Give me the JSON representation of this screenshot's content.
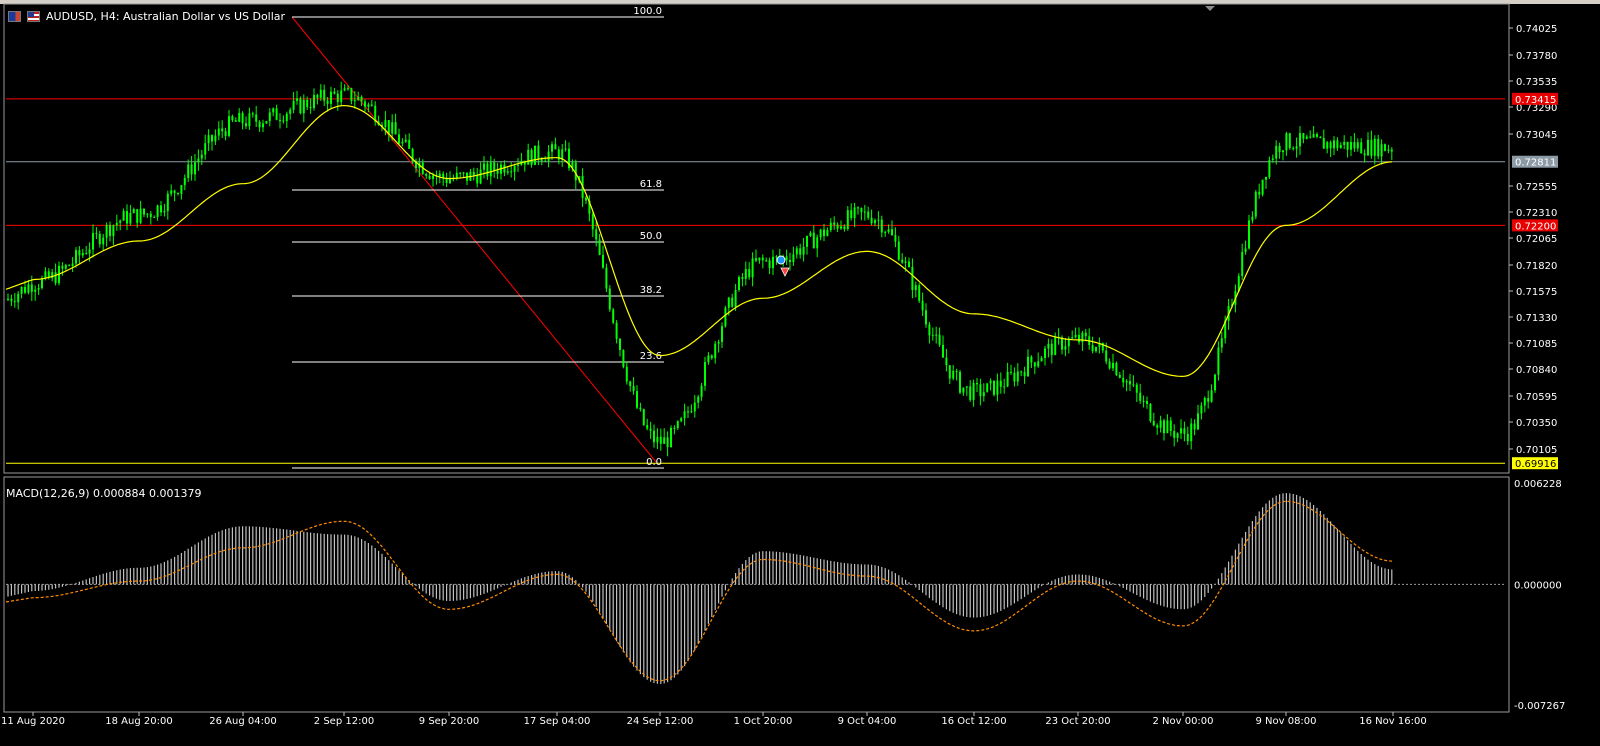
{
  "symbol_header": {
    "text": "AUDUSD, H4:  Australian Dollar vs US Dollar"
  },
  "macd": {
    "label": "MACD(12,26,9) 0.000884 0.001379",
    "axis_labels": [
      "0.006228",
      "0.000000",
      "-0.007267"
    ]
  },
  "price_axis": {
    "labels": [
      "0.74025",
      "0.73780",
      "0.73535",
      "0.73290",
      "0.73045",
      "0.72555",
      "0.72310",
      "0.72065",
      "0.71820",
      "0.71575",
      "0.71330",
      "0.71085",
      "0.70840",
      "0.70595",
      "0.70350",
      "0.70105"
    ],
    "tags": [
      {
        "text": "0.73415",
        "color": "#e80000"
      },
      {
        "text": "0.72811",
        "color": "#8c9aa6"
      },
      {
        "text": "0.72200",
        "color": "#e80000"
      },
      {
        "text": "0.69916",
        "color": "#ffff00"
      }
    ]
  },
  "fibonacci": {
    "levels": [
      "100.0",
      "61.8",
      "50.0",
      "38.2",
      "23.6",
      "0.0"
    ]
  },
  "time_axis": {
    "labels": [
      "11 Aug 2020",
      "18 Aug 20:00",
      "26 Aug 04:00",
      "2 Sep 12:00",
      "9 Sep 20:00",
      "17 Sep 04:00",
      "24 Sep 12:00",
      "1 Oct 20:00",
      "9 Oct 04:00",
      "16 Oct 12:00",
      "23 Oct 20:00",
      "2 Nov 00:00",
      "9 Nov 08:00",
      "16 Nov 16:00"
    ]
  },
  "colors": {
    "candles": "#00ff00",
    "moving_average": "#ffff00",
    "support_resistance": "#ff0000",
    "fib_lines": "#ffffff",
    "fib_trend": "#ff0000",
    "macd_histogram": "#c0c0c0",
    "macd_signal": "#ff8c00",
    "current_price_line": "#8c9aa6"
  },
  "chart_data": {
    "type": "candlestick",
    "x_label_dates": [
      "11 Aug 2020",
      "18 Aug 20:00",
      "26 Aug 04:00",
      "2 Sep 12:00",
      "9 Sep 20:00",
      "17 Sep 04:00",
      "24 Sep 12:00",
      "1 Oct 20:00",
      "9 Oct 04:00",
      "16 Oct 12:00",
      "23 Oct 20:00",
      "2 Nov 00:00",
      "9 Nov 08:00",
      "16 Nov 16:00"
    ],
    "close_at_labels": [
      0.7165,
      0.723,
      0.732,
      0.7345,
      0.7265,
      0.729,
      0.7012,
      0.7185,
      0.723,
      0.706,
      0.711,
      0.702,
      0.73,
      0.7295
    ],
    "ma_at_labels": [
      0.7168,
      0.7205,
      0.726,
      0.7335,
      0.7265,
      0.7285,
      0.7095,
      0.715,
      0.7195,
      0.7135,
      0.711,
      0.7075,
      0.722,
      0.7281
    ],
    "macd_hist_at_labels": [
      -0.0004,
      0.001,
      0.0035,
      0.003,
      -0.001,
      0.0008,
      -0.006,
      0.002,
      0.0012,
      -0.002,
      0.0006,
      -0.0015,
      0.0055,
      0.0009
    ],
    "macd_signal_at_labels": [
      -0.0008,
      0.0002,
      0.0022,
      0.0038,
      -0.0015,
      0.0006,
      -0.0058,
      0.0015,
      0.0005,
      -0.0028,
      0.0002,
      -0.0025,
      0.005,
      0.0014
    ],
    "y_range": [
      0.6987,
      0.7422
    ],
    "macd_range": [
      -0.007267,
      0.006228
    ],
    "support_levels": [
      0.73415,
      0.722
    ],
    "current_price": 0.72811,
    "fib_low": 0.69916
  }
}
